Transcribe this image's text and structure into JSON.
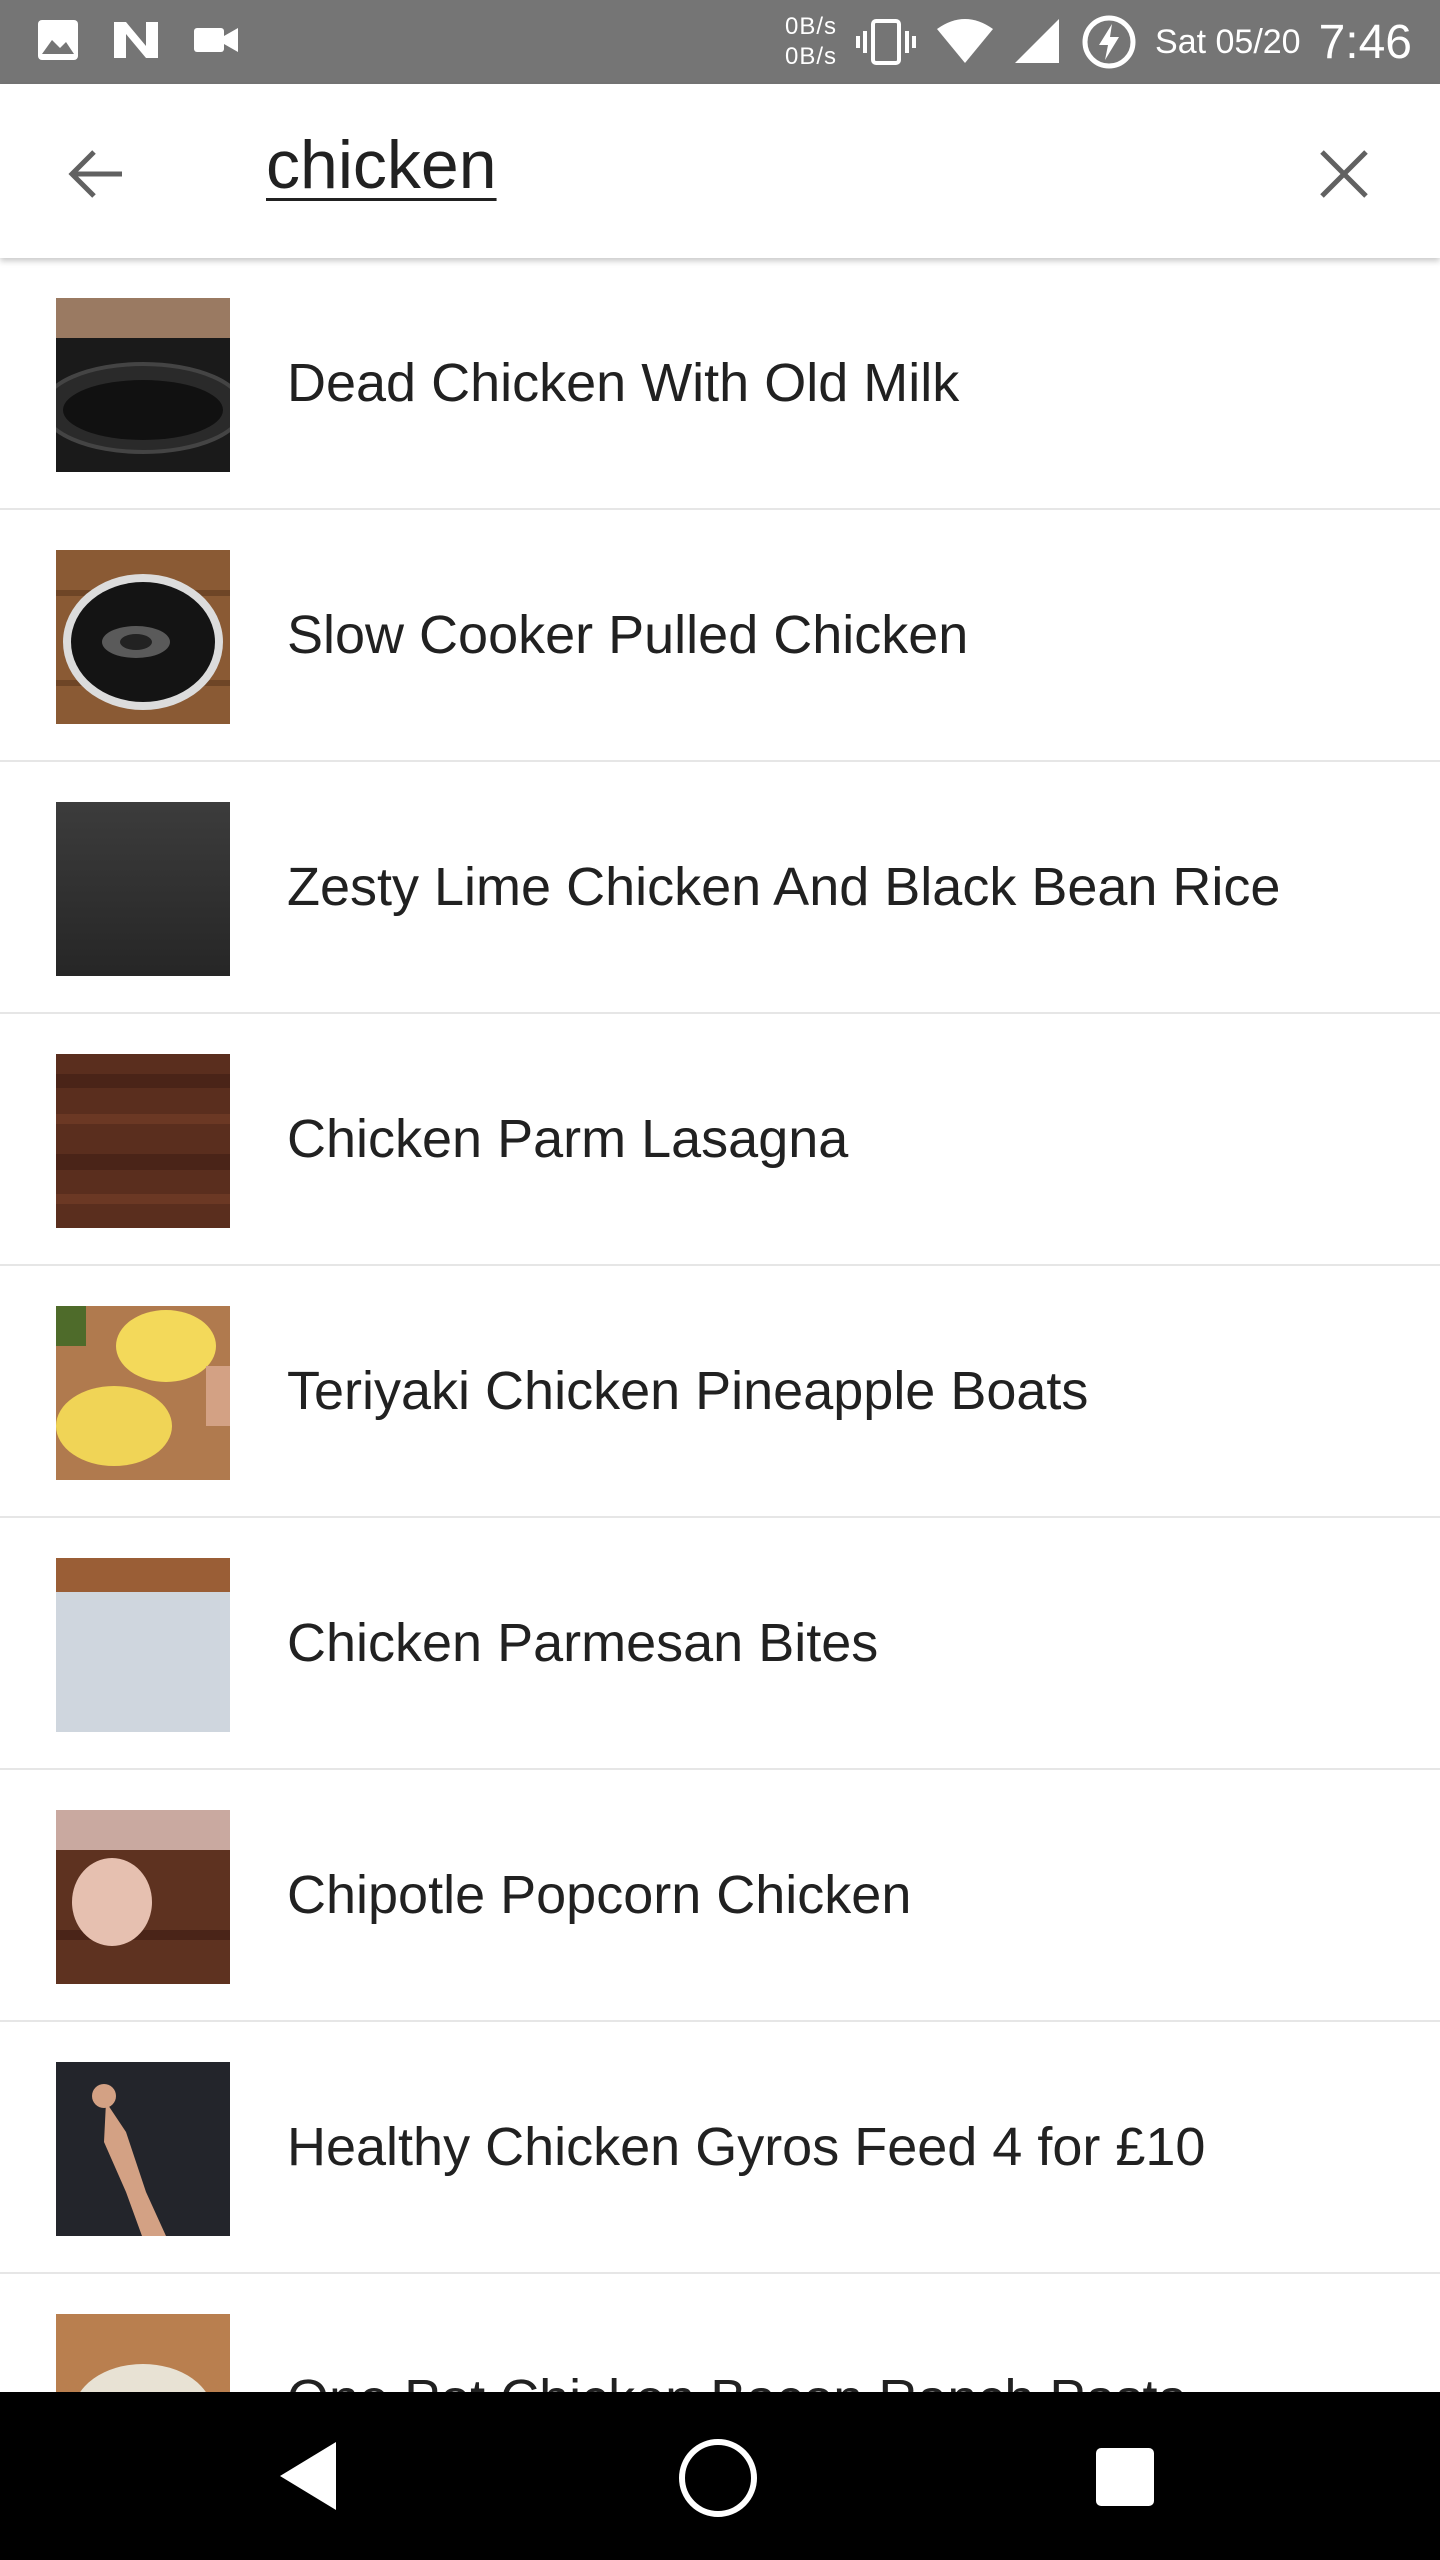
{
  "status_bar": {
    "net_up": "0B/s",
    "net_down": "0B/s",
    "date": "Sat 05/20",
    "time": "7:46",
    "icons": [
      "image-icon",
      "n-logo-icon",
      "video-icon",
      "vibrate-icon",
      "wifi-icon",
      "signal-icon",
      "battery-charging-icon"
    ]
  },
  "search": {
    "query": "chicken",
    "back_icon": "arrow-back-icon",
    "clear_icon": "close-icon"
  },
  "results": [
    {
      "title": "Dead Chicken With Old Milk"
    },
    {
      "title": "Slow Cooker Pulled Chicken"
    },
    {
      "title": "Zesty Lime Chicken And Black Bean Rice"
    },
    {
      "title": "Chicken Parm Lasagna"
    },
    {
      "title": "Teriyaki Chicken Pineapple Boats"
    },
    {
      "title": "Chicken Parmesan Bites"
    },
    {
      "title": "Chipotle Popcorn Chicken"
    },
    {
      "title": "Healthy Chicken Gyros Feed 4 for £10"
    },
    {
      "title": "One Pot Chicken Bacon Ranch Pasta"
    }
  ],
  "nav_bar": {
    "icons": [
      "nav-back-icon",
      "nav-home-icon",
      "nav-recents-icon"
    ]
  },
  "colors": {
    "status_bar_bg": "#757575",
    "nav_bar_bg": "#000000",
    "divider": "#e6e6e6"
  }
}
